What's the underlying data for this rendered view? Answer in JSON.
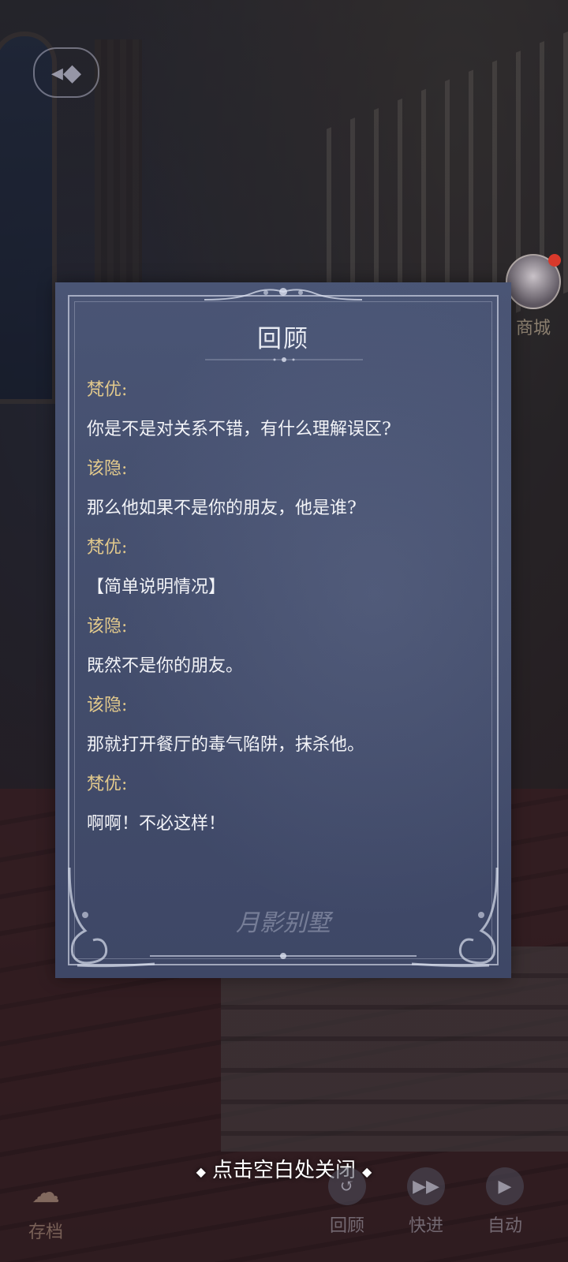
{
  "panel": {
    "title": "回顾",
    "entries": [
      {
        "speaker": "梵优:",
        "text": "你是不是对关系不错，有什么理解误区?"
      },
      {
        "speaker": "该隐:",
        "text": "那么他如果不是你的朋友，他是谁?"
      },
      {
        "speaker": "梵优:",
        "text": "【简单说明情况】"
      },
      {
        "speaker": "该隐:",
        "text": "既然不是你的朋友。"
      },
      {
        "speaker": "该隐:",
        "text": "那就打开餐厅的毒气陷阱，抹杀他。"
      },
      {
        "speaker": "梵优:",
        "text": "啊啊！不必这样！"
      }
    ],
    "watermark": "月影别墅"
  },
  "close_hint": "点击空白处关闭",
  "store": {
    "label": "商城"
  },
  "bottom_bar": {
    "save": "存档",
    "review": "回顾",
    "fast_forward": "快进",
    "auto": "自动"
  },
  "colors": {
    "speaker": "#e2c98c",
    "panel_bg": "#454f6e",
    "text": "#f2f3f7"
  }
}
